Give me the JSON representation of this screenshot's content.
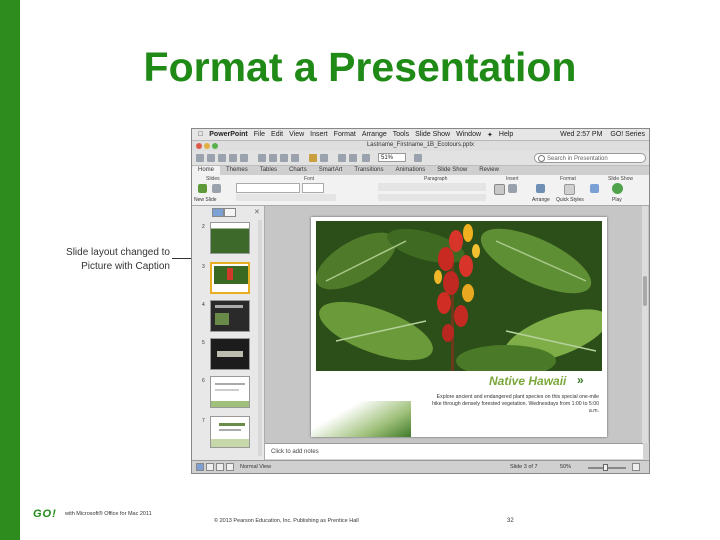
{
  "page": {
    "title": "Format a Presentation",
    "callout": {
      "line1": "Slide layout changed to",
      "line2": "Picture with Caption"
    },
    "footer": {
      "logo": "GO!",
      "book": "with Microsoft® Office for Mac 2011",
      "copyright": "© 2013 Pearson Education, Inc. Publishing as Prentice Hall",
      "page_number": "32"
    }
  },
  "app": {
    "menu": {
      "app_name": "PowerPoint",
      "items": [
        "File",
        "Edit",
        "View",
        "Insert",
        "Format",
        "Arrange",
        "Tools",
        "Slide Show",
        "Window",
        "Help"
      ],
      "clock": "Wed 2:57 PM",
      "user": "GO! Series"
    },
    "document_title": "Lastname_Firstname_1B_Ecotours.pptx",
    "toolbar": {
      "zoom": "51%",
      "search_placeholder": "Search in Presentation"
    },
    "ribbon_tabs": [
      "Home",
      "Themes",
      "Tables",
      "Charts",
      "SmartArt",
      "Transitions",
      "Animations",
      "Slide Show",
      "Review"
    ],
    "ribbon_groups": [
      "Slides",
      "Font",
      "Paragraph",
      "Insert",
      "Format",
      "Slide Show"
    ],
    "ribbon_buttons": {
      "new_slide": "New Slide",
      "arrange": "Arrange",
      "quick_styles": "Quick Styles",
      "play": "Play"
    },
    "thumbnails": [
      "2",
      "3",
      "4",
      "5",
      "6",
      "7"
    ],
    "slide": {
      "heading": "Native Hawaii",
      "body": "Explore ancient and endangered plant species on this special one-mile hike through densely forested vegetation. Wednesdays from 1:00 to 5:00 a.m."
    },
    "notes_placeholder": "Click to add notes",
    "status": {
      "view": "Normal View",
      "slide_count": "Slide 3 of 7",
      "zoom": "50%"
    },
    "colors": {
      "go_green": "#1f8a16",
      "accent_green": "#7aa63a",
      "selection": "#e8b020"
    }
  }
}
